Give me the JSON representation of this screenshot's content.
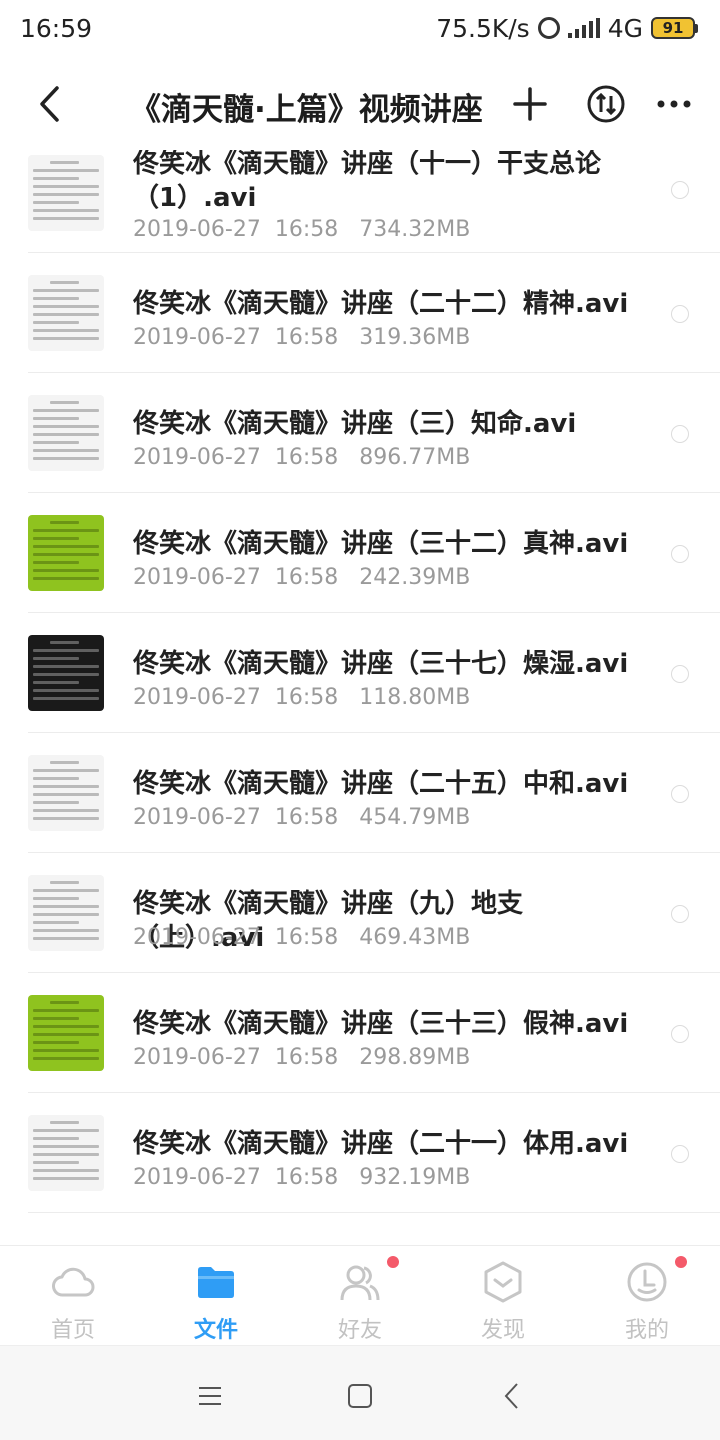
{
  "status_bar": {
    "time": "16:59",
    "net_speed": "75.5K/s",
    "network": "4G",
    "battery": "91"
  },
  "header": {
    "title": "《滴天髓·上篇》视频讲座",
    "back_icon": "chevron-left-icon",
    "add_icon": "plus-icon",
    "transfer_icon": "transfer-icon",
    "more_icon": "more-icon"
  },
  "files": [
    {
      "name": "佟笑冰《滴天髓》讲座（十一）干支总论（1）.avi",
      "date": "2019-06-27  16:58",
      "size": "734.32MB",
      "thumb": "doc"
    },
    {
      "name": "佟笑冰《滴天髓》讲座（二十二）精神.avi",
      "date": "2019-06-27  16:58",
      "size": "319.36MB",
      "thumb": "doc"
    },
    {
      "name": "佟笑冰《滴天髓》讲座（三）知命.avi",
      "date": "2019-06-27  16:58",
      "size": "896.77MB",
      "thumb": "doc"
    },
    {
      "name": "佟笑冰《滴天髓》讲座（三十二）真神.avi",
      "date": "2019-06-27  16:58",
      "size": "242.39MB",
      "thumb": "green"
    },
    {
      "name": "佟笑冰《滴天髓》讲座（三十七）燥湿.avi",
      "date": "2019-06-27  16:58",
      "size": "118.80MB",
      "thumb": "dark"
    },
    {
      "name": "佟笑冰《滴天髓》讲座（二十五）中和.avi",
      "date": "2019-06-27  16:58",
      "size": "454.79MB",
      "thumb": "doc"
    },
    {
      "name": "佟笑冰《滴天髓》讲座（九）地支（上）.avi",
      "date": "2019-06-27  16:58",
      "size": "469.43MB",
      "thumb": "doc"
    },
    {
      "name": "佟笑冰《滴天髓》讲座（三十三）假神.avi",
      "date": "2019-06-27  16:58",
      "size": "298.89MB",
      "thumb": "green"
    },
    {
      "name": "佟笑冰《滴天髓》讲座（二十一）体用.avi",
      "date": "2019-06-27  16:58",
      "size": "932.19MB",
      "thumb": "doc"
    }
  ],
  "tabs": [
    {
      "label": "首页",
      "icon": "cloud-icon",
      "active": false,
      "badge": false
    },
    {
      "label": "文件",
      "icon": "folder-icon",
      "active": true,
      "badge": false
    },
    {
      "label": "好友",
      "icon": "friends-icon",
      "active": false,
      "badge": true
    },
    {
      "label": "发现",
      "icon": "discover-icon",
      "active": false,
      "badge": false
    },
    {
      "label": "我的",
      "icon": "profile-icon",
      "active": false,
      "badge": true
    }
  ],
  "colors": {
    "accent": "#2f9df5",
    "badge": "#f45a6a",
    "battery": "#f1c232",
    "thumb_green": "#8fc31f",
    "thumb_dark": "#1a1a1a"
  }
}
